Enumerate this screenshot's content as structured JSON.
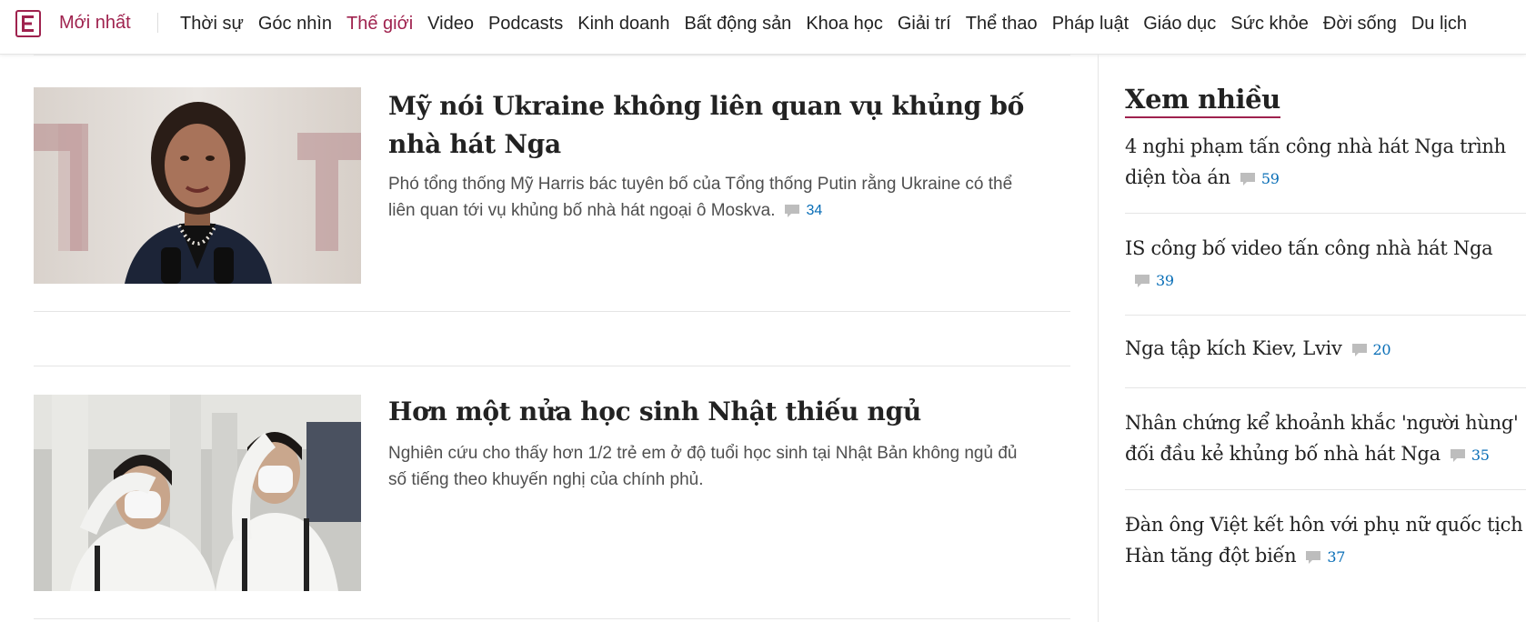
{
  "nav": {
    "logo_icon": "vnexpress-e-logo-icon",
    "latest_label": "Mới nhất",
    "brand_color": "#9f224e",
    "items": [
      {
        "label": "Thời sự",
        "active": false
      },
      {
        "label": "Góc nhìn",
        "active": false
      },
      {
        "label": "Thế giới",
        "active": true
      },
      {
        "label": "Video",
        "active": false
      },
      {
        "label": "Podcasts",
        "active": false
      },
      {
        "label": "Kinh doanh",
        "active": false
      },
      {
        "label": "Bất động sản",
        "active": false
      },
      {
        "label": "Khoa học",
        "active": false
      },
      {
        "label": "Giải trí",
        "active": false
      },
      {
        "label": "Thể thao",
        "active": false
      },
      {
        "label": "Pháp luật",
        "active": false
      },
      {
        "label": "Giáo dục",
        "active": false
      },
      {
        "label": "Sức khỏe",
        "active": false
      },
      {
        "label": "Đời sống",
        "active": false
      },
      {
        "label": "Du lịch",
        "active": false
      }
    ]
  },
  "articles": [
    {
      "title": "Mỹ nói Ukraine không liên quan vụ khủng bố nhà hát Nga",
      "description": "Phó tổng thống Mỹ Harris bác tuyên bố của Tổng thống Putin rằng Ukraine có thể liên quan tới vụ khủng bố nhà hát ngoại ô Moskva.",
      "comments": "34",
      "thumbnail": "woman-speaking-at-podium-photo"
    },
    {
      "title": "Hơn một nửa học sinh Nhật thiếu ngủ",
      "description": "Nghiên cứu cho thấy hơn 1/2 trẻ em ở độ tuổi học sinh tại Nhật Bản không ngủ đủ số tiếng theo khuyến nghị của chính phủ.",
      "comments": "",
      "thumbnail": "students-wearing-masks-photo"
    }
  ],
  "sidebar": {
    "heading": "Xem nhiều",
    "items": [
      {
        "title": "4 nghi phạm tấn công nhà hát Nga trình diện tòa án",
        "comments": "59"
      },
      {
        "title": "IS công bố video tấn công nhà hát Nga",
        "comments": "39"
      },
      {
        "title": "Nga tập kích Kiev, Lviv",
        "comments": "20"
      },
      {
        "title": "Nhân chứng kể khoảnh khắc 'người hùng' đối đầu kẻ khủng bố nhà hát Nga",
        "comments": "35"
      },
      {
        "title": "Đàn ông Việt kết hôn với phụ nữ quốc tịch Hàn tăng đột biến",
        "comments": "37"
      }
    ]
  },
  "icons": {
    "comment": "comment-bubble-icon"
  },
  "colors": {
    "link_blue": "#076db6",
    "comment_icon": "#bdbdbd"
  }
}
